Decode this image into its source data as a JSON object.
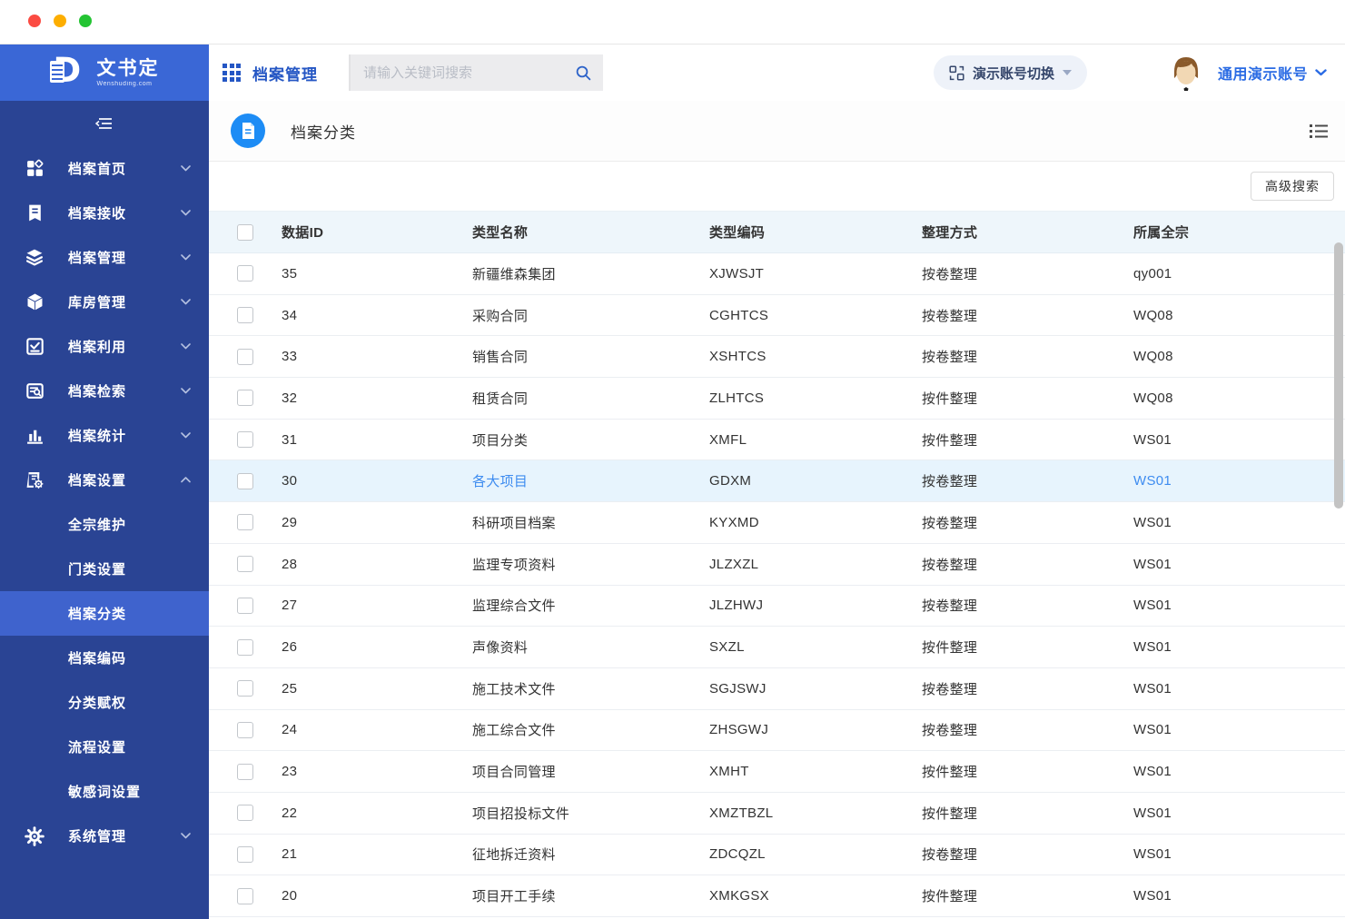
{
  "window": {
    "controls": [
      "close",
      "minimize",
      "zoom"
    ]
  },
  "brand": {
    "name": "文书定",
    "domain": "Wenshuding.com"
  },
  "topbar": {
    "app_title": "档案管理",
    "search_placeholder": "请输入关键词搜索",
    "account_switch_label": "演示账号切换",
    "account_name": "通用演示账号"
  },
  "sidebar": {
    "items": [
      {
        "label": "档案首页",
        "icon": "home-grid-icon",
        "chevron": "down"
      },
      {
        "label": "档案接收",
        "icon": "receive-doc-icon",
        "chevron": "down"
      },
      {
        "label": "档案管理",
        "icon": "layers-icon",
        "chevron": "down"
      },
      {
        "label": "库房管理",
        "icon": "cube-icon",
        "chevron": "down"
      },
      {
        "label": "档案利用",
        "icon": "checklist-icon",
        "chevron": "down"
      },
      {
        "label": "档案检索",
        "icon": "search-list-icon",
        "chevron": "down"
      },
      {
        "label": "档案统计",
        "icon": "bar-chart-icon",
        "chevron": "down"
      },
      {
        "label": "档案设置",
        "icon": "doc-gear-icon",
        "chevron": "up",
        "expanded": true,
        "children": [
          "全宗维护",
          "门类设置",
          "档案分类",
          "档案编码",
          "分类赋权",
          "流程设置",
          "敏感词设置"
        ],
        "active_child": "档案分类"
      },
      {
        "label": "系统管理",
        "icon": "gear-icon",
        "chevron": "down"
      }
    ]
  },
  "page": {
    "title": "档案分类"
  },
  "toolbar": {
    "advanced_search_label": "高级搜索"
  },
  "table": {
    "columns": [
      "数据ID",
      "类型名称",
      "类型编码",
      "整理方式",
      "所属全宗"
    ],
    "highlighted_id": "30",
    "rows": [
      {
        "id": "35",
        "name": "新疆维森集团",
        "code": "XJWSJT",
        "method": "按卷整理",
        "fonds": "qy001"
      },
      {
        "id": "34",
        "name": "采购合同",
        "code": "CGHTCS",
        "method": "按卷整理",
        "fonds": "WQ08"
      },
      {
        "id": "33",
        "name": "销售合同",
        "code": "XSHTCS",
        "method": "按卷整理",
        "fonds": "WQ08"
      },
      {
        "id": "32",
        "name": "租赁合同",
        "code": "ZLHTCS",
        "method": "按件整理",
        "fonds": "WQ08"
      },
      {
        "id": "31",
        "name": "项目分类",
        "code": "XMFL",
        "method": "按件整理",
        "fonds": "WS01"
      },
      {
        "id": "30",
        "name": "各大项目",
        "code": "GDXM",
        "method": "按卷整理",
        "fonds": "WS01"
      },
      {
        "id": "29",
        "name": "科研项目档案",
        "code": "KYXMD",
        "method": "按卷整理",
        "fonds": "WS01"
      },
      {
        "id": "28",
        "name": "监理专项资料",
        "code": "JLZXZL",
        "method": "按卷整理",
        "fonds": "WS01"
      },
      {
        "id": "27",
        "name": "监理综合文件",
        "code": "JLZHWJ",
        "method": "按卷整理",
        "fonds": "WS01"
      },
      {
        "id": "26",
        "name": "声像资料",
        "code": "SXZL",
        "method": "按件整理",
        "fonds": "WS01"
      },
      {
        "id": "25",
        "name": "施工技术文件",
        "code": "SGJSWJ",
        "method": "按卷整理",
        "fonds": "WS01"
      },
      {
        "id": "24",
        "name": "施工综合文件",
        "code": "ZHSGWJ",
        "method": "按卷整理",
        "fonds": "WS01"
      },
      {
        "id": "23",
        "name": "项目合同管理",
        "code": "XMHT",
        "method": "按件整理",
        "fonds": "WS01"
      },
      {
        "id": "22",
        "name": "项目招投标文件",
        "code": "XMZTBZL",
        "method": "按件整理",
        "fonds": "WS01"
      },
      {
        "id": "21",
        "name": "征地拆迁资料",
        "code": "ZDCQZL",
        "method": "按卷整理",
        "fonds": "WS01"
      },
      {
        "id": "20",
        "name": "项目开工手续",
        "code": "XMKGSX",
        "method": "按件整理",
        "fonds": "WS01"
      }
    ]
  },
  "colors": {
    "sidebar_bg": "#2a4494",
    "logo_band": "#3a67d6",
    "active_item": "#3f63cd",
    "accent_blue": "#2456c4",
    "link_blue": "#3e8cf0",
    "page_icon_blue": "#1d8cf5",
    "table_header_bg": "#eef6fb",
    "highlight_row_bg": "#e7f4fd"
  }
}
